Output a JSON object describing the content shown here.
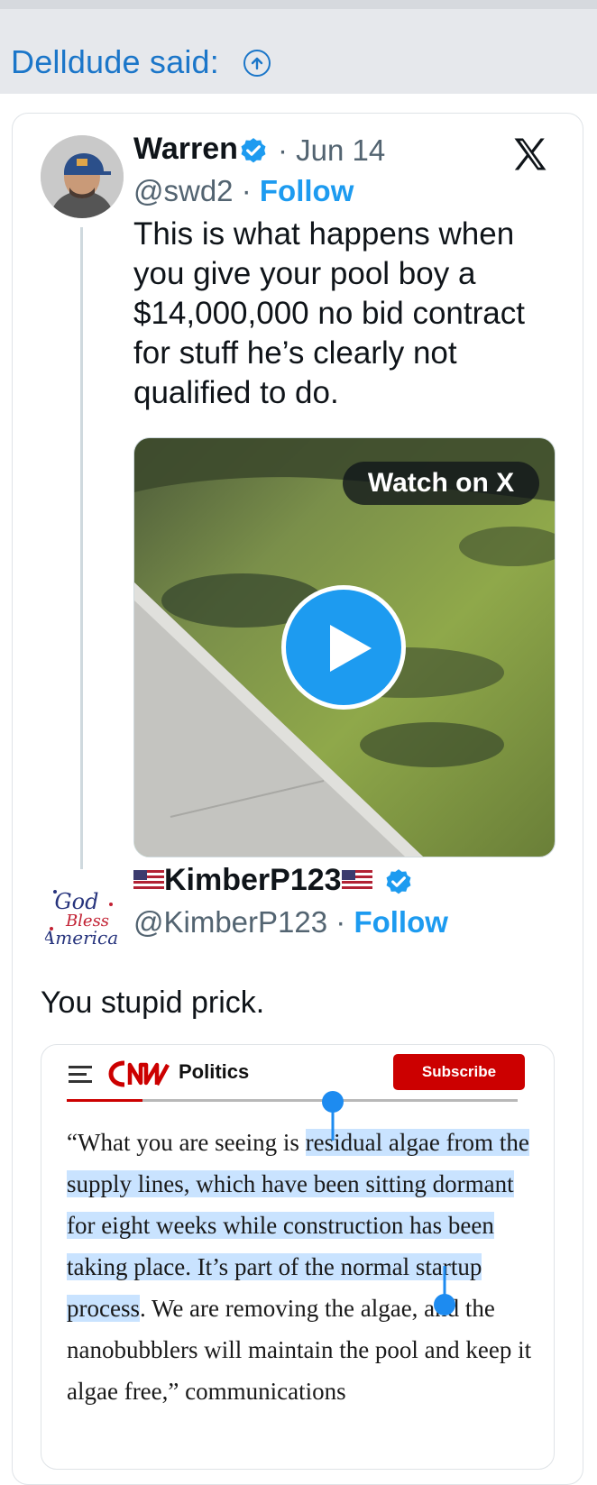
{
  "quote_header": {
    "text": "Delldude said:",
    "icon": "arrow-up-circle-icon"
  },
  "tweet": {
    "author_name": "Warren",
    "verified": true,
    "date_sep": "·",
    "date": "Jun 14",
    "handle": "@swd2",
    "sep": "·",
    "follow_label": "Follow",
    "text": "This is what happens when you give your pool boy a $14,000,000 no bid contract for stuff he’s clearly not qualified to do.",
    "media": {
      "watch_label": "Watch on X",
      "play_icon": "play-icon"
    },
    "platform_icon": "x-logo-icon"
  },
  "reply": {
    "author_name": "KimberP123",
    "flag_icon": "us-flag-icon",
    "verified": true,
    "handle": "@KimberP123",
    "sep": "·",
    "follow_label": "Follow",
    "avatar_text": "God Bless America",
    "text": "You stupid prick.",
    "article": {
      "brand": "CNN",
      "section": "Politics",
      "subscribe_label": "Subscribe",
      "body_pre": "“What you are seeing is ",
      "body_highlight": "residual algae from the supply lines, which have been sitting dormant for eight weeks while construction has been taking place. It’s part of the normal startup process",
      "body_post": ". We are removing the algae, and the nanobubblers will maintain the pool and keep it algae free,” communications"
    }
  },
  "colors": {
    "link_blue": "#1d9bf0",
    "header_blue": "#1b76c9",
    "cnn_red": "#cc0000",
    "highlight": "#c9e3ff"
  }
}
